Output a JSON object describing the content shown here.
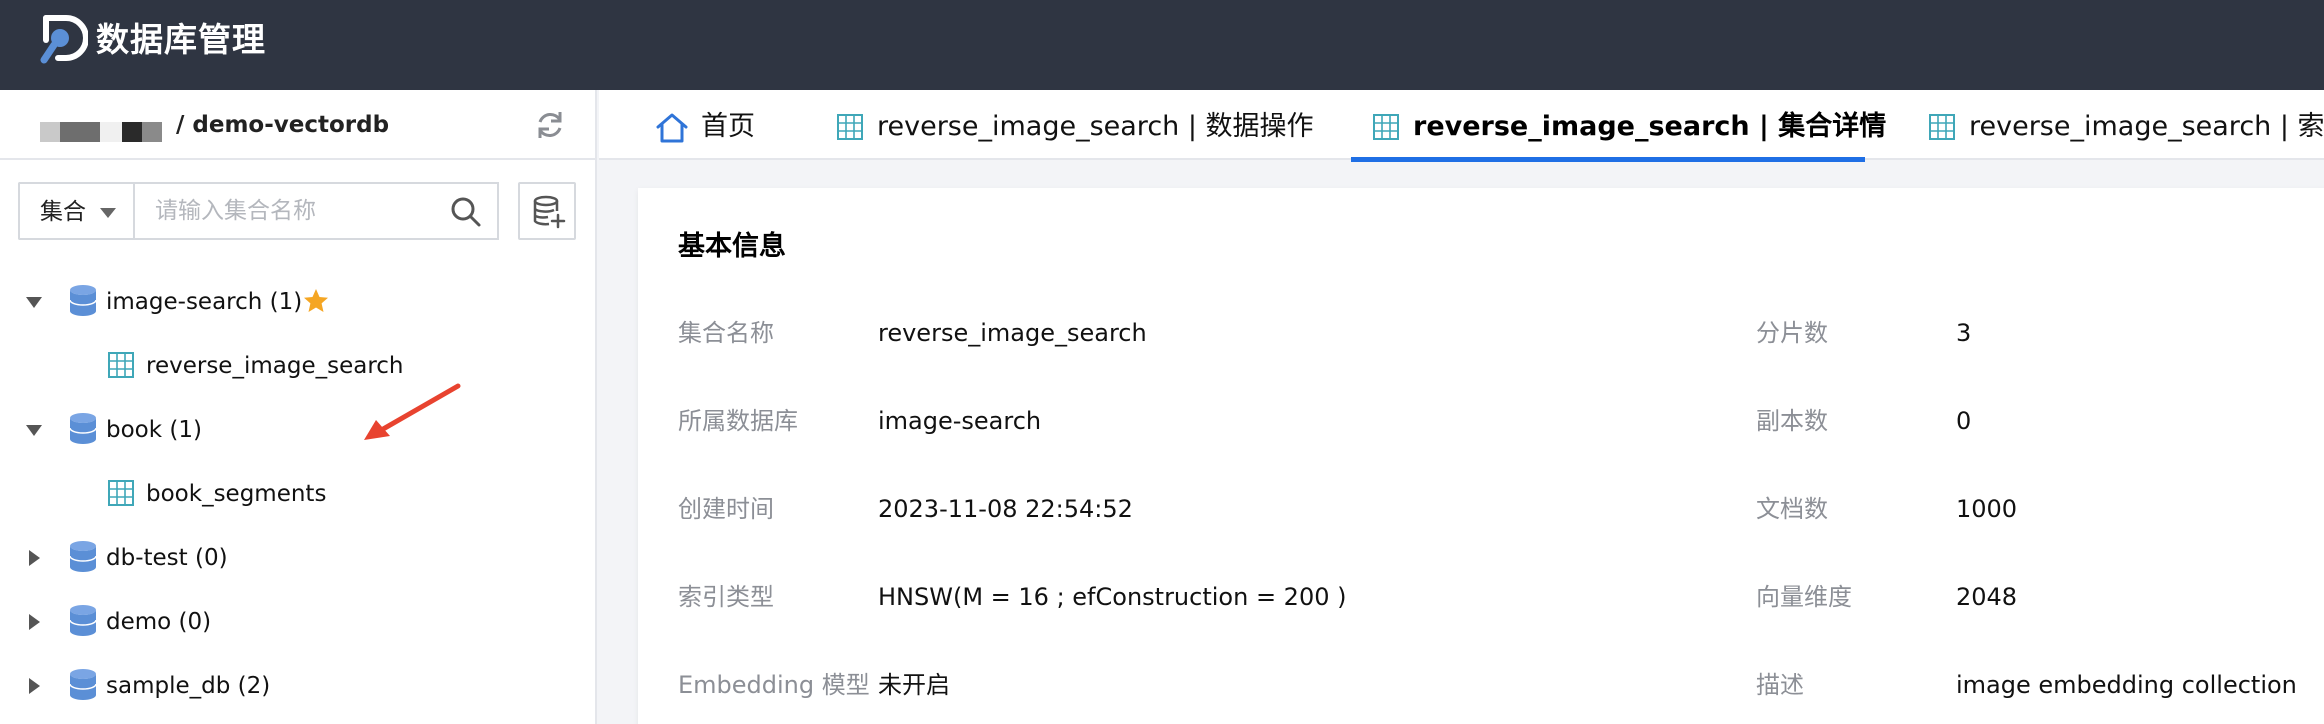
{
  "app": {
    "title": "数据库管理"
  },
  "connection": {
    "name": "/ demo-vectordb"
  },
  "filter": {
    "select_label": "集合",
    "placeholder": "请输入集合名称"
  },
  "tree": [
    {
      "label": "image-search (1)",
      "expanded": true,
      "starred": true
    },
    {
      "label": "reverse_image_search",
      "child": true
    },
    {
      "label": "book (1)",
      "expanded": true
    },
    {
      "label": "book_segments",
      "child": true
    },
    {
      "label": "db-test (0)",
      "expanded": false
    },
    {
      "label": "demo (0)",
      "expanded": false
    },
    {
      "label": "sample_db (2)",
      "expanded": false
    }
  ],
  "tabs": [
    {
      "label": "首页",
      "icon": "home-icon"
    },
    {
      "label": "reverse_image_search | 数据操作",
      "icon": "table-icon"
    },
    {
      "label": "reverse_image_search | 集合详情",
      "icon": "table-icon",
      "active": true
    },
    {
      "label": "reverse_image_search | 索引",
      "icon": "table-icon"
    }
  ],
  "basic_info": {
    "title": "基本信息",
    "left": [
      {
        "label": "集合名称",
        "value": "reverse_image_search"
      },
      {
        "label": "所属数据库",
        "value": "image-search"
      },
      {
        "label": "创建时间",
        "value": "2023-11-08 22:54:52"
      },
      {
        "label": "索引类型",
        "value": "HNSW(M = 16 ; efConstruction = 200 )"
      },
      {
        "label": "Embedding 模型",
        "value": "未开启"
      }
    ],
    "right": [
      {
        "label": "分片数",
        "value": "3"
      },
      {
        "label": "副本数",
        "value": "0"
      },
      {
        "label": "文档数",
        "value": "1000"
      },
      {
        "label": "向量维度",
        "value": "2048"
      },
      {
        "label": "描述",
        "value": "image embedding collection"
      }
    ]
  },
  "colors": {
    "topbar": "#2f3542",
    "accent": "#1f6fe5",
    "star": "#f5a623",
    "annotation": "#e8432f",
    "db_icon": "#5b8fd6"
  }
}
